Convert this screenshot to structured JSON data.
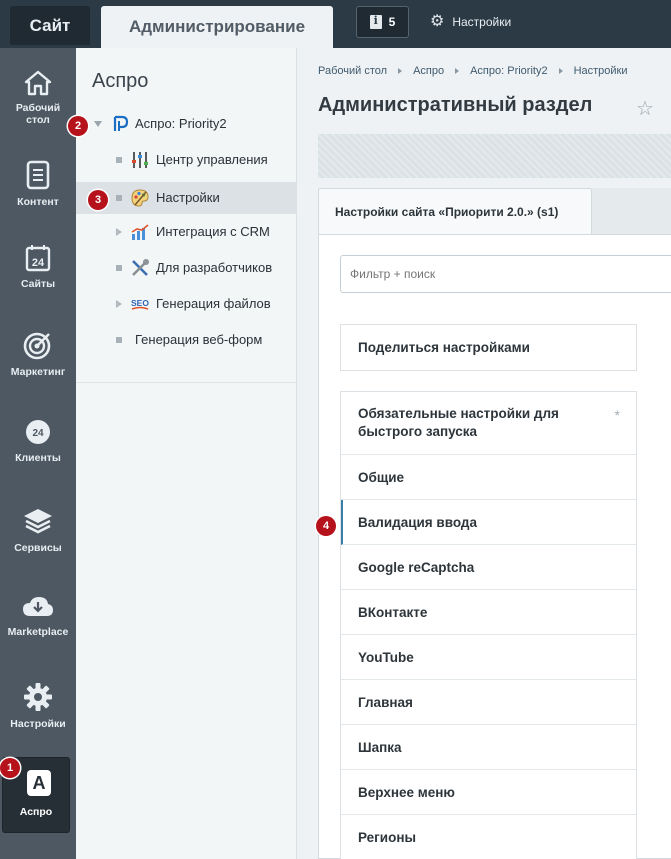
{
  "topbar": {
    "site_tab": "Сайт",
    "admin_tab": "Администрирование",
    "notifications_count": "5",
    "settings_label": "Настройки"
  },
  "leftnav": {
    "items": [
      {
        "label": "Рабочий стол",
        "icon": "home-icon"
      },
      {
        "label": "Контент",
        "icon": "document-icon"
      },
      {
        "label": "Сайты",
        "icon": "calendar-24-icon"
      },
      {
        "label": "Маркетинг",
        "icon": "target-icon"
      },
      {
        "label": "Клиенты",
        "icon": "clients-24-icon"
      },
      {
        "label": "Сервисы",
        "icon": "layers-icon"
      },
      {
        "label": "Marketplace",
        "icon": "cloud-download-icon"
      },
      {
        "label": "Настройки",
        "icon": "gear-icon"
      }
    ],
    "active": {
      "label": "Аспро",
      "letter": "A"
    }
  },
  "menu": {
    "title": "Аспро",
    "root": {
      "label": "Аспро: Priority2"
    },
    "items": [
      {
        "label": "Центр управления",
        "icon": "sliders-icon"
      },
      {
        "label": "Настройки",
        "icon": "palette-icon"
      },
      {
        "label": "Интеграция с CRM",
        "icon": "chart-icon"
      },
      {
        "label": "Для разработчиков",
        "icon": "tools-icon"
      },
      {
        "label": "Генерация файлов",
        "icon": "seo-icon"
      },
      {
        "label": "Генерация веб-форм",
        "icon": ""
      }
    ]
  },
  "badges": [
    "1",
    "2",
    "3",
    "4"
  ],
  "main": {
    "breadcrumbs": [
      "Рабочий стол",
      "Аспро",
      "Аспро: Priority2",
      "Настройки"
    ],
    "title": "Административный раздел",
    "tab_label": "Настройки сайта «Приорити 2.0.» (s1)",
    "filter_placeholder": "Фильтр + поиск",
    "share_label": "Поделиться настройками",
    "settings": [
      "Обязательные настройки для быстрого запуска",
      "Общие",
      "Валидация ввода",
      "Google reCaptcha",
      "ВКонтакте",
      "YouTube",
      "Главная",
      "Шапка",
      "Верхнее меню",
      "Регионы"
    ],
    "required_mark": "*"
  }
}
